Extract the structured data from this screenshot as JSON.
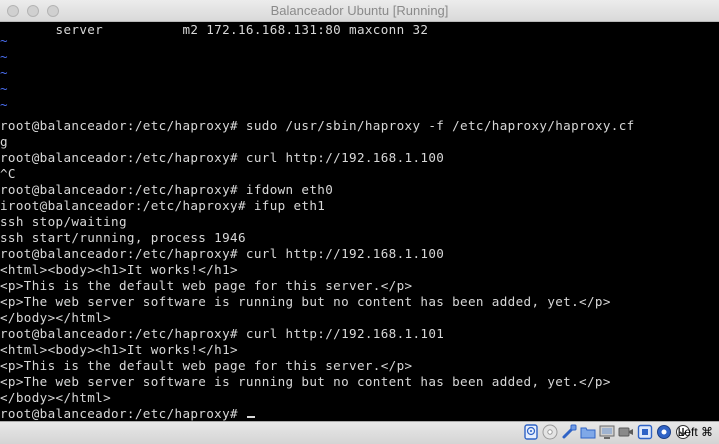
{
  "window": {
    "title": "Balanceador Ubuntu [Running]"
  },
  "terminal": {
    "lines": [
      "       server          m2 172.16.168.131:80 maxconn 32",
      "~",
      "~",
      "~",
      "~",
      "~",
      "root@balanceador:/etc/haproxy# sudo /usr/sbin/haproxy -f /etc/haproxy/haproxy.cf",
      "g",
      "root@balanceador:/etc/haproxy# curl http://192.168.1.100",
      "^C",
      "root@balanceador:/etc/haproxy# ifdown eth0",
      "iroot@balanceador:/etc/haproxy# ifup eth1",
      "ssh stop/waiting",
      "ssh start/running, process 1946",
      "root@balanceador:/etc/haproxy# curl http://192.168.1.100",
      "<html><body><h1>It works!</h1>",
      "<p>This is the default web page for this server.</p>",
      "<p>The web server software is running but no content has been added, yet.</p>",
      "</body></html>",
      "root@balanceador:/etc/haproxy# curl http://192.168.1.101",
      "<html><body><h1>It works!</h1>",
      "<p>This is the default web page for this server.</p>",
      "<p>The web server software is running but no content has been added, yet.</p>",
      "</body></html>",
      "root@balanceador:/etc/haproxy# "
    ]
  },
  "statusbar": {
    "host_key": "Left ⌘",
    "icons": [
      "hard-disk-icon",
      "optical-drive-icon",
      "usb-icon",
      "shared-folders-icon",
      "display-icon",
      "video-capture-icon",
      "network-icon",
      "guest-additions-icon",
      "mouse-integration-icon",
      "keyboard-capture-icon"
    ]
  },
  "colors": {
    "tilde": "#4a6ef0",
    "text": "#d8d8d8",
    "background": "#000000"
  }
}
